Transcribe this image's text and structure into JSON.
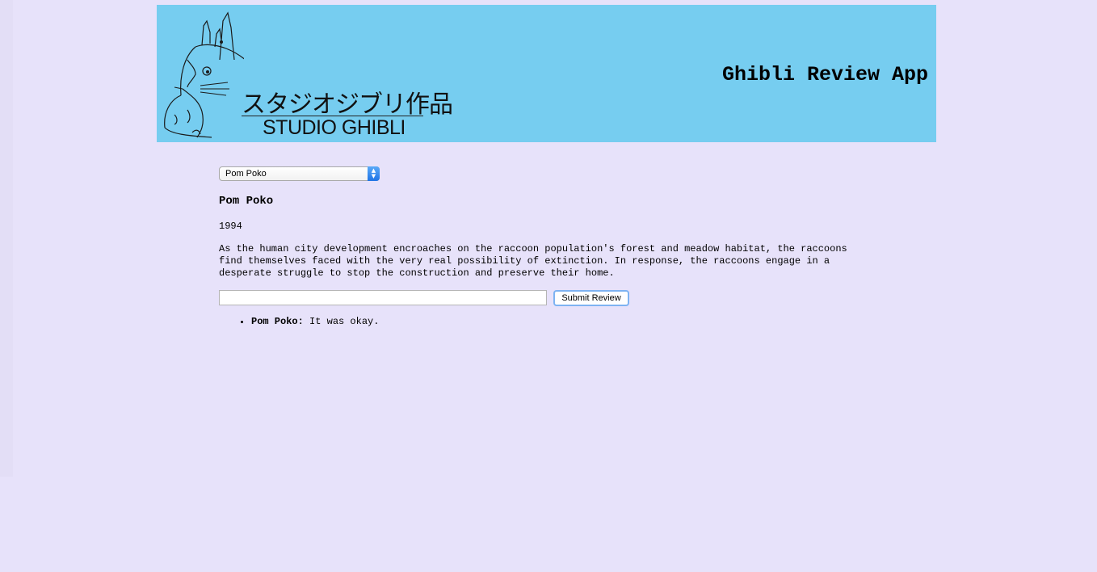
{
  "header": {
    "app_title": "Ghibli Review App",
    "logo_text_jp": "スタジオジブリ作品",
    "logo_text_en": "STUDIO GHIBLI",
    "background": "#76cdf0"
  },
  "film_select": {
    "selected": "Pom Poko",
    "accent": "#1f74e6"
  },
  "film": {
    "title": "Pom Poko",
    "year": "1994",
    "description": "As the human city development encroaches on the raccoon population's forest and meadow habitat, the raccoons find themselves faced with the very real possibility of extinction. In response, the raccoons engage in a desperate struggle to stop the construction and preserve their home."
  },
  "review_form": {
    "input_value": "",
    "submit_label": "Submit Review"
  },
  "reviews": [
    {
      "film": "Pom Poko:",
      "text": " It was okay."
    }
  ],
  "page": {
    "background": "#e7e2fa"
  }
}
